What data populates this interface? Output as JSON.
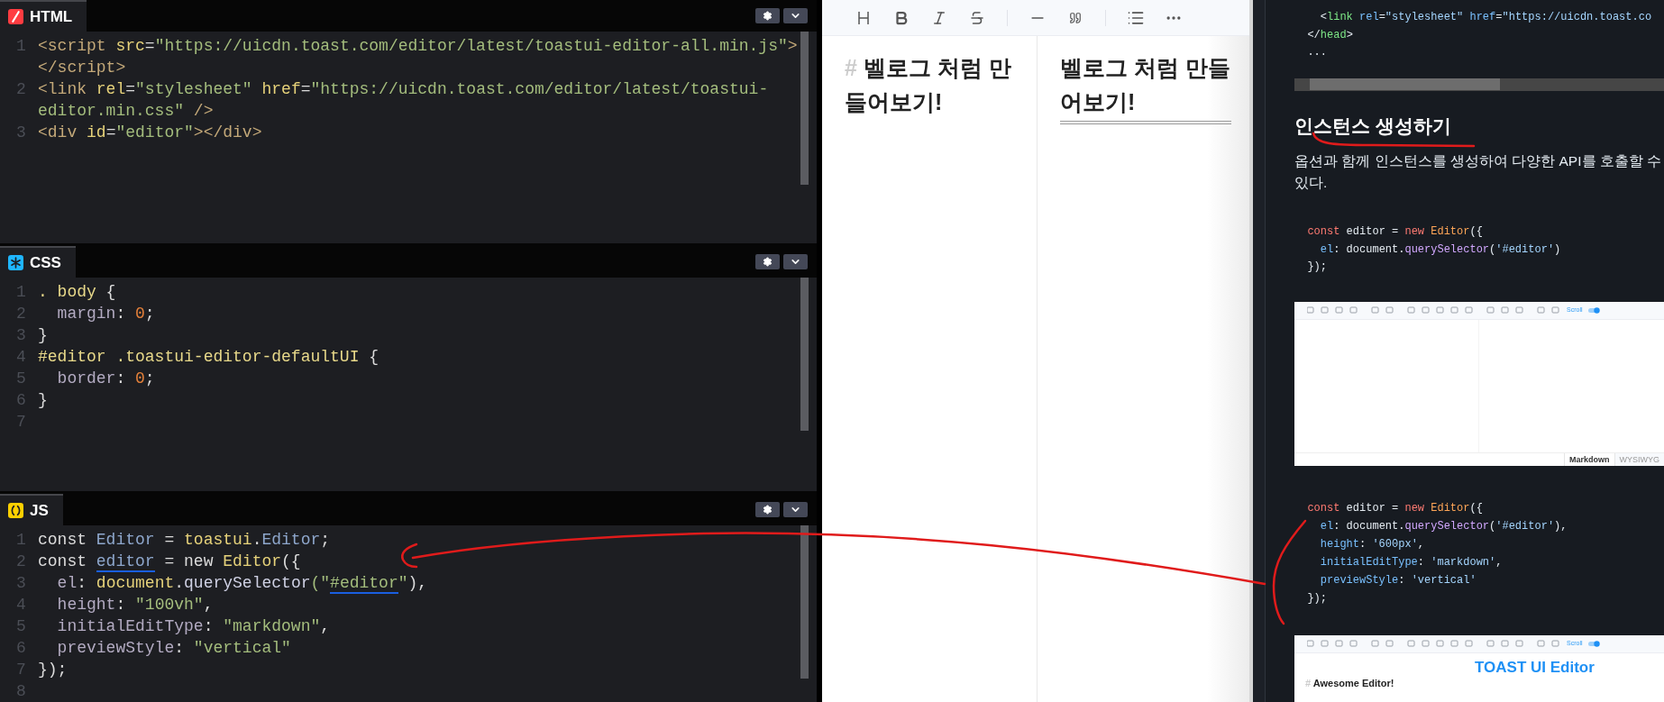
{
  "editors": [
    {
      "title": "HTML",
      "kind": "html",
      "color": "#ff3c41",
      "rows": [
        {
          "n": "1",
          "tokens": [
            {
              "text": "<script",
              "kind": "tag"
            },
            {
              "text": " src",
              "kind": "attr"
            },
            {
              "text": "=",
              "kind": "punct"
            },
            {
              "text": "\"https://uicdn.toast.com/editor/latest/toastui-editor-all.min.js\"",
              "kind": "str"
            },
            {
              "text": ">",
              "kind": "tag"
            }
          ]
        },
        {
          "tokens": [
            {
              "text": "</script>",
              "kind": "tag"
            }
          ]
        },
        {
          "n": "2",
          "tokens": [
            {
              "text": "<link",
              "kind": "tag"
            },
            {
              "text": " rel",
              "kind": "attr"
            },
            {
              "text": "=",
              "kind": "punct"
            },
            {
              "text": "\"stylesheet\"",
              "kind": "str"
            },
            {
              "text": " href",
              "kind": "attr"
            },
            {
              "text": "=",
              "kind": "punct"
            },
            {
              "text": "\"https://uicdn.toast.com/editor/latest/toastui-",
              "kind": "str"
            }
          ]
        },
        {
          "tokens": [
            {
              "text": "editor.min.css\"",
              "kind": "str"
            },
            {
              "text": " />",
              "kind": "tag"
            }
          ]
        },
        {
          "n": "3",
          "tokens": [
            {
              "text": "<div",
              "kind": "tag"
            },
            {
              "text": " id",
              "kind": "attr"
            },
            {
              "text": "=",
              "kind": "punct"
            },
            {
              "text": "\"editor\"",
              "kind": "str"
            },
            {
              "text": "></div>",
              "kind": "tag"
            }
          ]
        }
      ]
    },
    {
      "title": "CSS",
      "kind": "css",
      "color": "#1fb6ff",
      "rows": [
        {
          "n": "1",
          "tokens": [
            {
              "text": ". body",
              "kind": "sel"
            },
            {
              "text": " {",
              "kind": "punct"
            }
          ]
        },
        {
          "n": "2",
          "tokens": [
            {
              "text": "  margin",
              "kind": "prop"
            },
            {
              "text": ": ",
              "kind": "punct"
            },
            {
              "text": "0",
              "kind": "num"
            },
            {
              "text": ";",
              "kind": "punct"
            }
          ]
        },
        {
          "n": "3",
          "tokens": [
            {
              "text": "}",
              "kind": "punct"
            }
          ]
        },
        {
          "n": "4",
          "tokens": [
            {
              "text": "#editor .toastui-editor-defaultUI",
              "kind": "sel"
            },
            {
              "text": " {",
              "kind": "punct"
            }
          ]
        },
        {
          "n": "5",
          "tokens": [
            {
              "text": "  border",
              "kind": "prop"
            },
            {
              "text": ": ",
              "kind": "punct"
            },
            {
              "text": "0",
              "kind": "num"
            },
            {
              "text": ";",
              "kind": "punct"
            }
          ]
        },
        {
          "n": "6",
          "tokens": [
            {
              "text": "}",
              "kind": "punct"
            }
          ]
        },
        {
          "n": "7"
        }
      ]
    },
    {
      "title": "JS",
      "kind": "js",
      "color": "#fcd000",
      "rows": [
        {
          "n": "1",
          "tokens": [
            {
              "text": "const ",
              "kind": "kw"
            },
            {
              "text": "Editor",
              "kind": "type"
            },
            {
              "text": " = ",
              "kind": "punct"
            },
            {
              "text": "toastui",
              "kind": "obj"
            },
            {
              "text": ".",
              "kind": "punct"
            },
            {
              "text": "Editor",
              "kind": "type"
            },
            {
              "text": ";",
              "kind": "punct"
            }
          ]
        },
        {
          "n": "2",
          "tokens": [
            {
              "text": "const ",
              "kind": "kw"
            },
            {
              "text": "editor",
              "kind": "var-marked"
            },
            {
              "text": " = ",
              "kind": "punct"
            },
            {
              "text": "new ",
              "kind": "kw"
            },
            {
              "text": "Editor",
              "kind": "obj"
            },
            {
              "text": "({",
              "kind": "punct"
            }
          ]
        },
        {
          "n": "3",
          "tokens": [
            {
              "text": "  el",
              "kind": "prop"
            },
            {
              "text": ": ",
              "kind": "punct"
            },
            {
              "text": "document",
              "kind": "obj"
            },
            {
              "text": ".",
              "kind": "punct"
            },
            {
              "text": "querySelector",
              "kind": "fn"
            },
            {
              "text": "(\"",
              "kind": "str"
            },
            {
              "text": "#editor",
              "kind": "str-marked"
            },
            {
              "text": "\"",
              "kind": "str"
            },
            {
              "text": "),",
              "kind": "punct"
            }
          ]
        },
        {
          "n": "4",
          "tokens": [
            {
              "text": "  height",
              "kind": "prop"
            },
            {
              "text": ": ",
              "kind": "punct"
            },
            {
              "text": "\"100vh\"",
              "kind": "str"
            },
            {
              "text": ",",
              "kind": "punct"
            }
          ]
        },
        {
          "n": "5",
          "tokens": [
            {
              "text": "  initialEditType",
              "kind": "prop"
            },
            {
              "text": ": ",
              "kind": "punct"
            },
            {
              "text": "\"markdown\"",
              "kind": "str"
            },
            {
              "text": ",",
              "kind": "punct"
            }
          ]
        },
        {
          "n": "6",
          "tokens": [
            {
              "text": "  previewStyle",
              "kind": "prop"
            },
            {
              "text": ": ",
              "kind": "punct"
            },
            {
              "text": "\"vertical\"",
              "kind": "str"
            }
          ]
        },
        {
          "n": "7",
          "tokens": [
            {
              "text": "});",
              "kind": "punct"
            }
          ]
        },
        {
          "n": "8"
        }
      ]
    }
  ],
  "markdown_editor": {
    "source": {
      "marker": "#",
      "text": "벨로그 처럼 만들어보기!"
    },
    "preview": {
      "heading": "벨로그 처럼 만들어보기!"
    }
  },
  "article": {
    "top_code": [
      {
        "tokens": [
          {
            "text": "    <",
            "kind": "punct"
          },
          {
            "text": "link",
            "kind": "tag"
          },
          {
            "text": " rel",
            "kind": "attr"
          },
          {
            "text": "=",
            "kind": "punct"
          },
          {
            "text": "\"stylesheet\"",
            "kind": "str"
          },
          {
            "text": " href",
            "kind": "attr"
          },
          {
            "text": "=",
            "kind": "punct"
          },
          {
            "text": "\"https://uicdn.toast.co",
            "kind": "str"
          }
        ]
      },
      {
        "tokens": [
          {
            "text": "  </",
            "kind": "punct"
          },
          {
            "text": "head",
            "kind": "tag"
          },
          {
            "text": ">",
            "kind": "punct"
          }
        ]
      },
      {
        "tokens": [
          {
            "text": "  ...",
            "kind": "plain"
          }
        ]
      }
    ],
    "heading": "인스턴스 생성하기",
    "paragraph": "옵션과 함께 인스턴스를 생성하여 다양한 API를 호출할 수 있다.",
    "code_1": [
      {
        "tokens": [
          {
            "text": "  const",
            "kind": "kw"
          },
          {
            "text": " editor = ",
            "kind": "plain"
          },
          {
            "text": "new",
            "kind": "kw"
          },
          {
            "text": " Editor",
            "kind": "type"
          },
          {
            "text": "({",
            "kind": "plain"
          }
        ]
      },
      {
        "tokens": [
          {
            "text": "    el",
            "kind": "prop"
          },
          {
            "text": ": document.",
            "kind": "plain"
          },
          {
            "text": "querySelector",
            "kind": "fn"
          },
          {
            "text": "(",
            "kind": "plain"
          },
          {
            "text": "'#editor'",
            "kind": "str"
          },
          {
            "text": ")",
            "kind": "plain"
          }
        ]
      },
      {
        "tokens": [
          {
            "text": "  });",
            "kind": "plain"
          }
        ]
      }
    ],
    "screenshot_1": {
      "toggle_label": "Scroll",
      "tabs": [
        {
          "label": "Markdown",
          "selected": true
        },
        {
          "label": "WYSIWYG",
          "selected": false
        }
      ]
    },
    "code_2": [
      {
        "tokens": [
          {
            "text": "  const",
            "kind": "kw"
          },
          {
            "text": " editor = ",
            "kind": "plain"
          },
          {
            "text": "new",
            "kind": "kw"
          },
          {
            "text": " Editor",
            "kind": "type"
          },
          {
            "text": "({",
            "kind": "plain"
          }
        ]
      },
      {
        "tokens": [
          {
            "text": "    el",
            "kind": "prop"
          },
          {
            "text": ": document.",
            "kind": "plain"
          },
          {
            "text": "querySelector",
            "kind": "fn"
          },
          {
            "text": "(",
            "kind": "plain"
          },
          {
            "text": "'#editor'",
            "kind": "str"
          },
          {
            "text": "),",
            "kind": "plain"
          }
        ]
      },
      {
        "tokens": [
          {
            "text": "    height",
            "kind": "prop"
          },
          {
            "text": ": ",
            "kind": "plain"
          },
          {
            "text": "'600px'",
            "kind": "str"
          },
          {
            "text": ",",
            "kind": "plain"
          }
        ]
      },
      {
        "tokens": [
          {
            "text": "    initialEditType",
            "kind": "prop"
          },
          {
            "text": ": ",
            "kind": "plain"
          },
          {
            "text": "'markdown'",
            "kind": "str"
          },
          {
            "text": ",",
            "kind": "plain"
          }
        ]
      },
      {
        "tokens": [
          {
            "text": "    previewStyle",
            "kind": "prop"
          },
          {
            "text": ": ",
            "kind": "plain"
          },
          {
            "text": "'vertical'",
            "kind": "str"
          }
        ]
      },
      {
        "tokens": [
          {
            "text": "  });",
            "kind": "plain"
          }
        ]
      }
    ],
    "screenshot_2": {
      "toggle_label": "Scroll",
      "source_marker": "#",
      "source_heading": "Awesome Editor!",
      "logo": "TOAST UI Editor"
    }
  }
}
